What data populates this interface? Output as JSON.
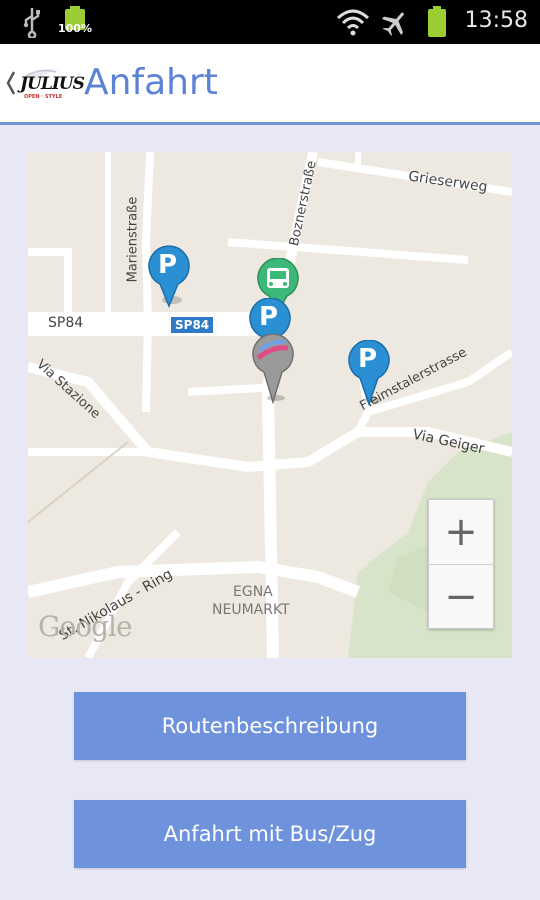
{
  "status_bar": {
    "time": "13:58",
    "battery_level_label": "100%",
    "icons": [
      "usb-icon",
      "battery-full-icon",
      "wifi-icon",
      "airplane-mode-icon",
      "battery-icon"
    ]
  },
  "app_bar": {
    "title": "Anfahrt",
    "logo_text": "JULIUS",
    "logo_subtext": "OPEN · STYLE"
  },
  "map": {
    "roads": {
      "sp84": "SP84",
      "sp84_badge": "SP84",
      "marienstrasse": "Marienstraße",
      "boznerstrasse": "Boznerstraße",
      "grieserweg": "Grieserweg",
      "via_stazione": "Via Stazione",
      "fleimstalerstrasse": "Fleimstalerstrasse",
      "via_geiger": "Via Geiger",
      "st_nikolaus_ring": "St. Nikolaus - Ring"
    },
    "place": {
      "line1": "EGNA",
      "line2": "NEUMARKT"
    },
    "attribution": "Google",
    "zoom_in": "+",
    "zoom_out": "−",
    "markers": [
      {
        "type": "parking",
        "letter": "P"
      },
      {
        "type": "bus",
        "letter": ""
      },
      {
        "type": "parking",
        "letter": "P"
      },
      {
        "type": "store",
        "letter": ""
      },
      {
        "type": "parking",
        "letter": "P"
      }
    ],
    "colors": {
      "land": "#eee9e0",
      "road": "#ffffff",
      "park": "#d6e3c8",
      "parking_marker": "#2b8fd4",
      "bus_marker": "#3cb878",
      "badge": "#2f7bc8"
    }
  },
  "buttons": {
    "route": "Routenbeschreibung",
    "transit": "Anfahrt mit Bus/Zug"
  }
}
